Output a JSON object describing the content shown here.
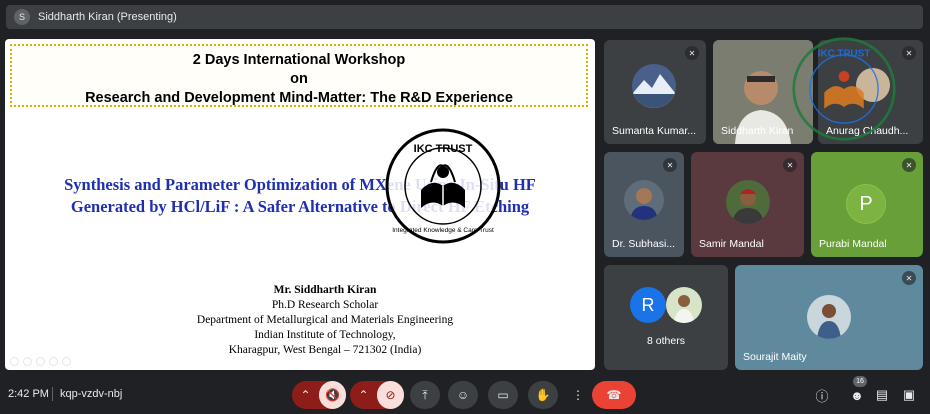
{
  "topbar": {
    "avatar_letter": "S",
    "presenter_label": "Siddharth Kiran (Presenting)"
  },
  "slide": {
    "banner_lines": [
      "2 Days International Workshop",
      "on",
      "Research and Development Mind-Matter: The R&D Experience"
    ],
    "talk_title_lines": [
      "Synthesis and Parameter Optimization of MXene Using In-Situ HF",
      "Generated by HCl/LiF : A Safer Alternative to Direct HF Etching"
    ],
    "author_name": "Mr. Siddharth Kiran",
    "author_lines": [
      "Ph.D Research Scholar",
      "Department of Metallurgical and Materials Engineering",
      "Indian Institute of Technology,",
      "Kharagpur, West Bengal – 721302 (India)"
    ]
  },
  "logo": {
    "title": "IKC TRUST",
    "subtitle": "Integrated Knowledge & Care Trust"
  },
  "participants": [
    {
      "name": "Sumanta Kumar...",
      "muted": true
    },
    {
      "name": "Siddharth Kiran",
      "muted": false
    },
    {
      "name": "Anurag Chaudh...",
      "muted": true
    },
    {
      "name": "Dr. Subhasi...",
      "muted": true
    },
    {
      "name": "Samir Mandal",
      "muted": true
    },
    {
      "name": "Purabi Mandal",
      "muted": true,
      "initial": "P"
    },
    {
      "name": "8 others",
      "initial": "R"
    },
    {
      "name": "Sourajit Maity",
      "muted": true
    }
  ],
  "bottombar": {
    "time": "2:42 PM",
    "meeting_code": "kqp-vzdv-nbj",
    "people_count": "16"
  },
  "colors": {
    "background": "#202124",
    "tile": "#3c4043",
    "end_call": "#ea4335",
    "slide_title": "#1f2fb3"
  }
}
